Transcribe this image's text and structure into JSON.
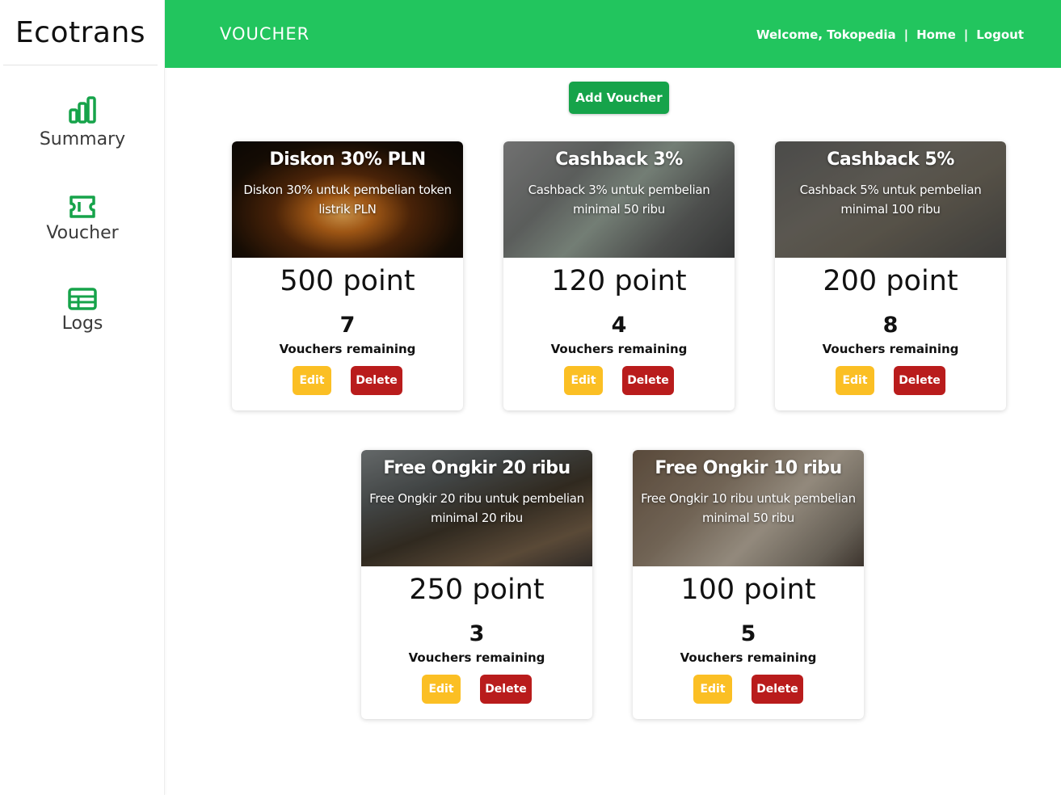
{
  "sidebar": {
    "brand": "Ecotrans",
    "items": [
      {
        "label": "Summary",
        "icon": "bar-chart-icon"
      },
      {
        "label": "Voucher",
        "icon": "ticket-icon"
      },
      {
        "label": "Logs",
        "icon": "table-icon"
      }
    ]
  },
  "header": {
    "title": "VOUCHER",
    "welcome": "Welcome, Tokopedia",
    "sep": "|",
    "home": "Home",
    "logout": "Logout"
  },
  "actions": {
    "add_voucher": "Add Voucher",
    "edit": "Edit",
    "delete": "Delete",
    "remaining_label": "Vouchers remaining"
  },
  "colors": {
    "brand_green": "#22c55e",
    "button_green": "#16a34a",
    "edit_yellow": "#fbbf24",
    "delete_red": "#b91c1c"
  },
  "vouchers": [
    {
      "title": "Diskon 30% PLN",
      "description": "Diskon 30% untuk pembelian token listrik PLN",
      "points": "500 point",
      "remaining": "7"
    },
    {
      "title": "Cashback 3%",
      "description": "Cashback 3% untuk pembelian minimal 50 ribu",
      "points": "120 point",
      "remaining": "4"
    },
    {
      "title": "Cashback 5%",
      "description": "Cashback 5% untuk pembelian minimal 100 ribu",
      "points": "200 point",
      "remaining": "8"
    },
    {
      "title": "Free Ongkir 20 ribu",
      "description": "Free Ongkir 20 ribu untuk pembelian minimal 20 ribu",
      "points": "250 point",
      "remaining": "3"
    },
    {
      "title": "Free Ongkir 10 ribu",
      "description": "Free Ongkir 10 ribu untuk pembelian minimal 50 ribu",
      "points": "100 point",
      "remaining": "5"
    }
  ]
}
